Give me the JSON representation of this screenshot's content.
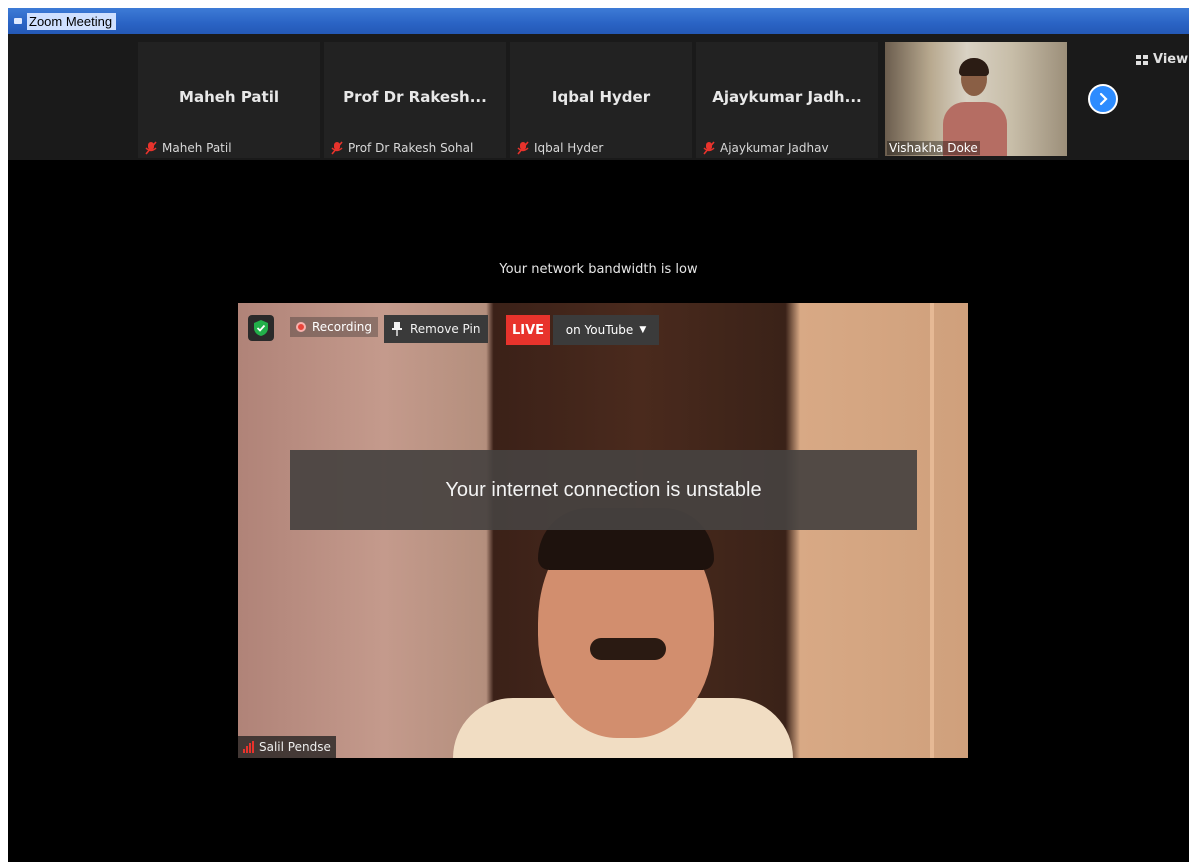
{
  "window": {
    "title": "Zoom Meeting"
  },
  "strip": {
    "tiles": [
      {
        "name": "Maheh Patil",
        "label": "Maheh Patil"
      },
      {
        "name": "Prof Dr Rakesh...",
        "label": "Prof Dr Rakesh Sohal"
      },
      {
        "name": "Iqbal Hyder",
        "label": "Iqbal Hyder"
      },
      {
        "name": "Ajaykumar Jadh...",
        "label": "Ajaykumar Jadhav"
      }
    ],
    "video_tile": {
      "label": "Vishakha Doke"
    },
    "view_label": "View"
  },
  "notices": {
    "bandwidth": "Your network bandwidth is low",
    "unstable": "Your internet connection is unstable"
  },
  "main_video": {
    "recording_label": "Recording",
    "remove_pin_label": "Remove Pin",
    "live_label": "LIVE",
    "stream_label": "on YouTube",
    "speaker_name": "Salil Pendse"
  },
  "colors": {
    "accent": "#2d8cff",
    "live": "#e8332c",
    "muted_icon": "#e8332c"
  }
}
